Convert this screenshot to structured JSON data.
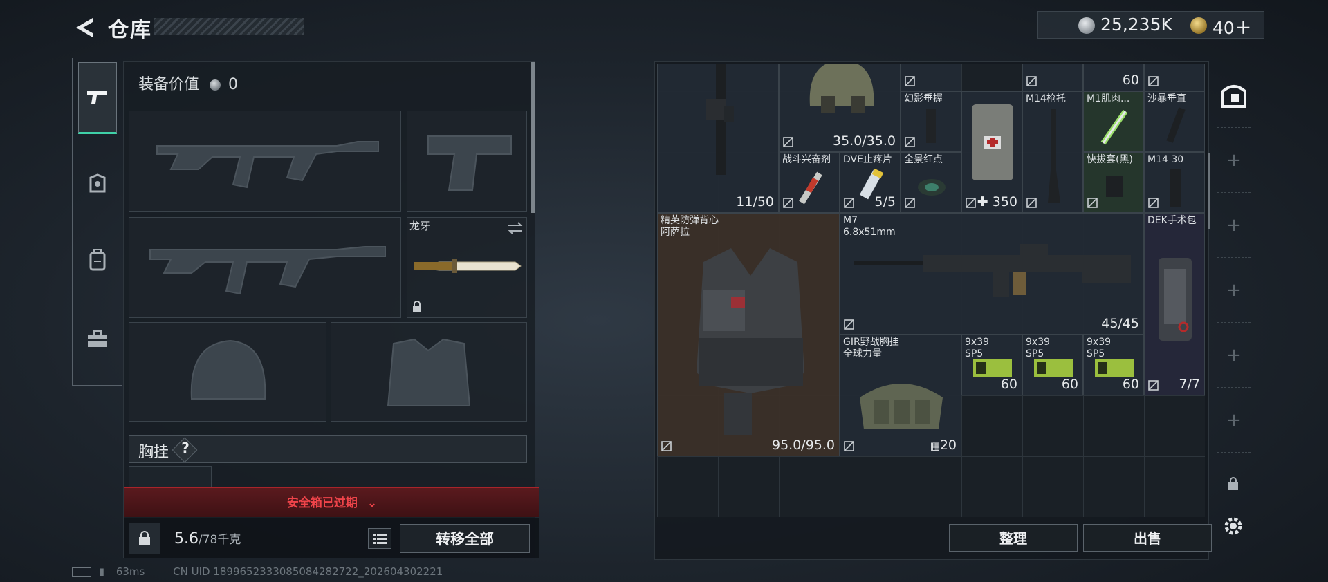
{
  "header": {
    "title": "仓库",
    "currency_primary": "25,235K",
    "currency_secondary": "40＋"
  },
  "left_tabs": [
    {
      "name": "weapon-tab"
    },
    {
      "name": "armor-tab"
    },
    {
      "name": "backpack-tab"
    },
    {
      "name": "briefcase-tab"
    }
  ],
  "equipment": {
    "value_label": "装备价值",
    "value_amount": "0",
    "knife_name": "龙牙",
    "vest_section_label": "胸挂",
    "help_mark": "?"
  },
  "safe_box": {
    "expired_text": "安全箱已过期"
  },
  "bottom_left": {
    "weight_current": "5.6",
    "weight_max": "/78千克",
    "transfer_all_label": "转移全部"
  },
  "status": {
    "latency": "63ms",
    "uid": "CN UID 1899652333085084282722_202604302221"
  },
  "inventory": {
    "items": [
      {
        "name": "",
        "count": "11/50"
      },
      {
        "name": "",
        "count": "35.0/35.0"
      },
      {
        "name": "幻影垂握",
        "count": ""
      },
      {
        "name": "",
        "count": "350"
      },
      {
        "name": "M14枪托",
        "count": ""
      },
      {
        "name": "M1肌肉...",
        "count": ""
      },
      {
        "name": "沙暴垂直",
        "count": ""
      },
      {
        "name": "",
        "count": "60"
      },
      {
        "name": "战斗兴奋剂",
        "count": ""
      },
      {
        "name": "DVE止疼片",
        "count": "5/5"
      },
      {
        "name": "全景红点",
        "count": ""
      },
      {
        "name": "快拔套(黑)",
        "count": ""
      },
      {
        "name": "M14 30",
        "count": ""
      },
      {
        "name": "精英防弹背心\n阿萨拉",
        "count": "95.0/95.0"
      },
      {
        "name": "M7\n6.8x51mm",
        "count": "45/45"
      },
      {
        "name": "DEK手术包",
        "count": "7/7"
      },
      {
        "name": "GIR野战胸挂\n全球力量",
        "count": "20"
      },
      {
        "name": "9x39\nSP5",
        "count": "60"
      },
      {
        "name": "9x39\nSP5",
        "count": "60"
      },
      {
        "name": "9x39\nSP5",
        "count": "60"
      }
    ],
    "sort_label": "整理",
    "sell_label": "出售"
  },
  "colors": {
    "expired_red": "#f0444a",
    "panel_dark": "#171d23",
    "vest_cell": "#3a3029"
  }
}
